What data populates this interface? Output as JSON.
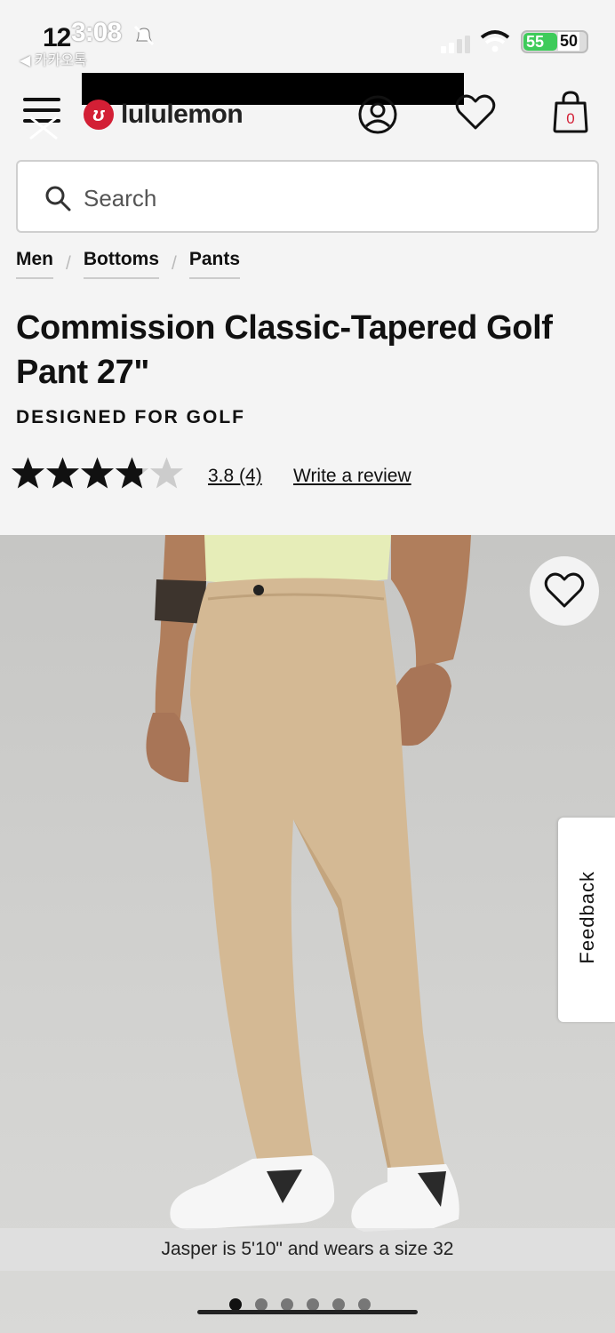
{
  "status_bar": {
    "time_under": "12",
    "time": "3:08",
    "back_app": "◀ 카카오톡",
    "battery_percent": "55",
    "battery_other": "50"
  },
  "header": {
    "brand": "lululemon",
    "cart_count": "0"
  },
  "search": {
    "placeholder": "Search"
  },
  "breadcrumb": [
    {
      "label": "Men"
    },
    {
      "label": "Bottoms"
    },
    {
      "label": "Pants"
    }
  ],
  "product": {
    "title": "Commission Classic-Tapered Golf Pant 27\"",
    "subtitle": "DESIGNED FOR GOLF",
    "rating_value": 3.8,
    "rating_text": "3.8 (4)",
    "write_review": "Write a review",
    "stars_filled": 4,
    "stars_total": 5
  },
  "gallery": {
    "caption": "Jasper is 5'10\" and wears a size 32",
    "image_count": 6,
    "active_index": 0,
    "feedback_label": "Feedback"
  },
  "colors": {
    "brand_red": "#d31f35",
    "pant_khaki": "#d4b994",
    "shirt_yellow": "#e6edb8"
  }
}
